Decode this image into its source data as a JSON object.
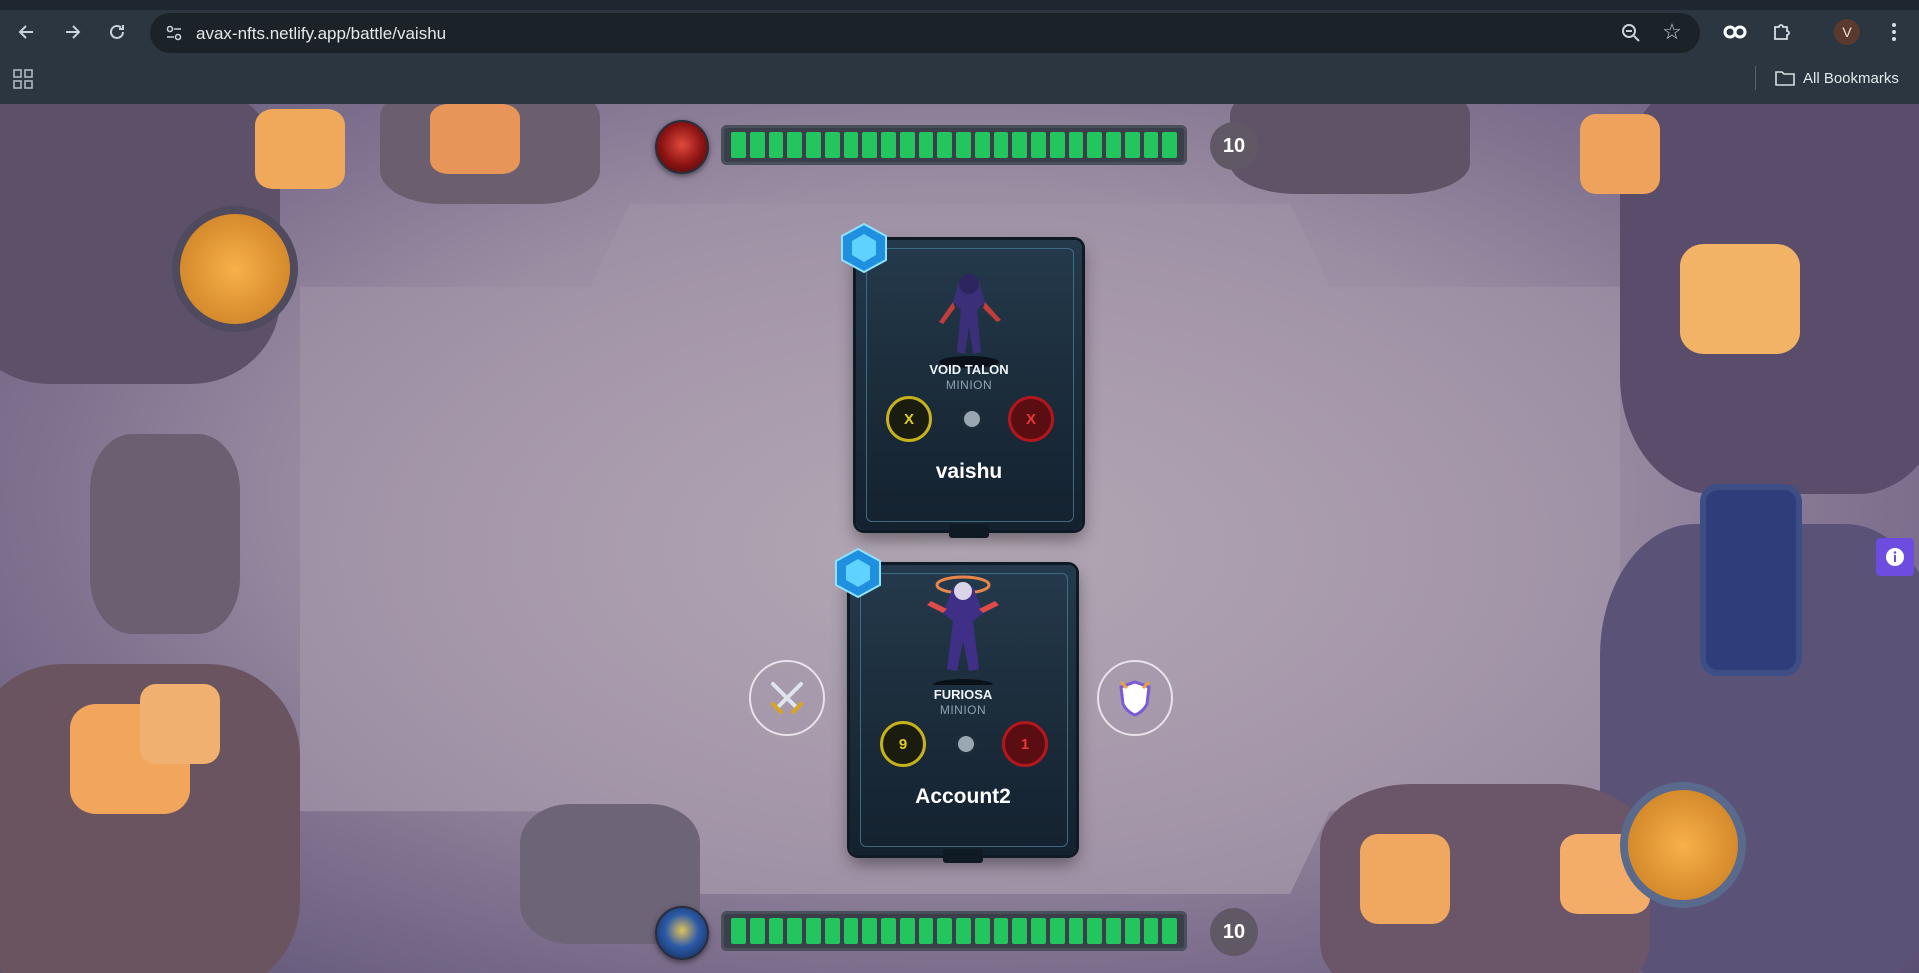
{
  "browser": {
    "url": "avax-nfts.netlify.app/battle/vaishu",
    "profile_initial": "V",
    "bookmarks_label": "All Bookmarks"
  },
  "battle": {
    "opponent": {
      "hp": "10",
      "hp_fraction": 1.0,
      "player_name": "vaishu",
      "card_name": "VOID TALON",
      "card_type": "MINION",
      "attack": "X",
      "defense": "X"
    },
    "player": {
      "hp": "10",
      "hp_fraction": 1.0,
      "player_name": "Account2",
      "card_name": "FURIOSA",
      "card_type": "MINION",
      "attack": "9",
      "defense": "1"
    },
    "actions": {
      "attack_icon": "crossed-swords-icon",
      "defend_icon": "shield-icon"
    }
  },
  "colors": {
    "hp_green": "#22c55e",
    "info_button": "#6d4de0",
    "attack_gold": "#e2cb28",
    "defense_red": "#e8373b"
  }
}
